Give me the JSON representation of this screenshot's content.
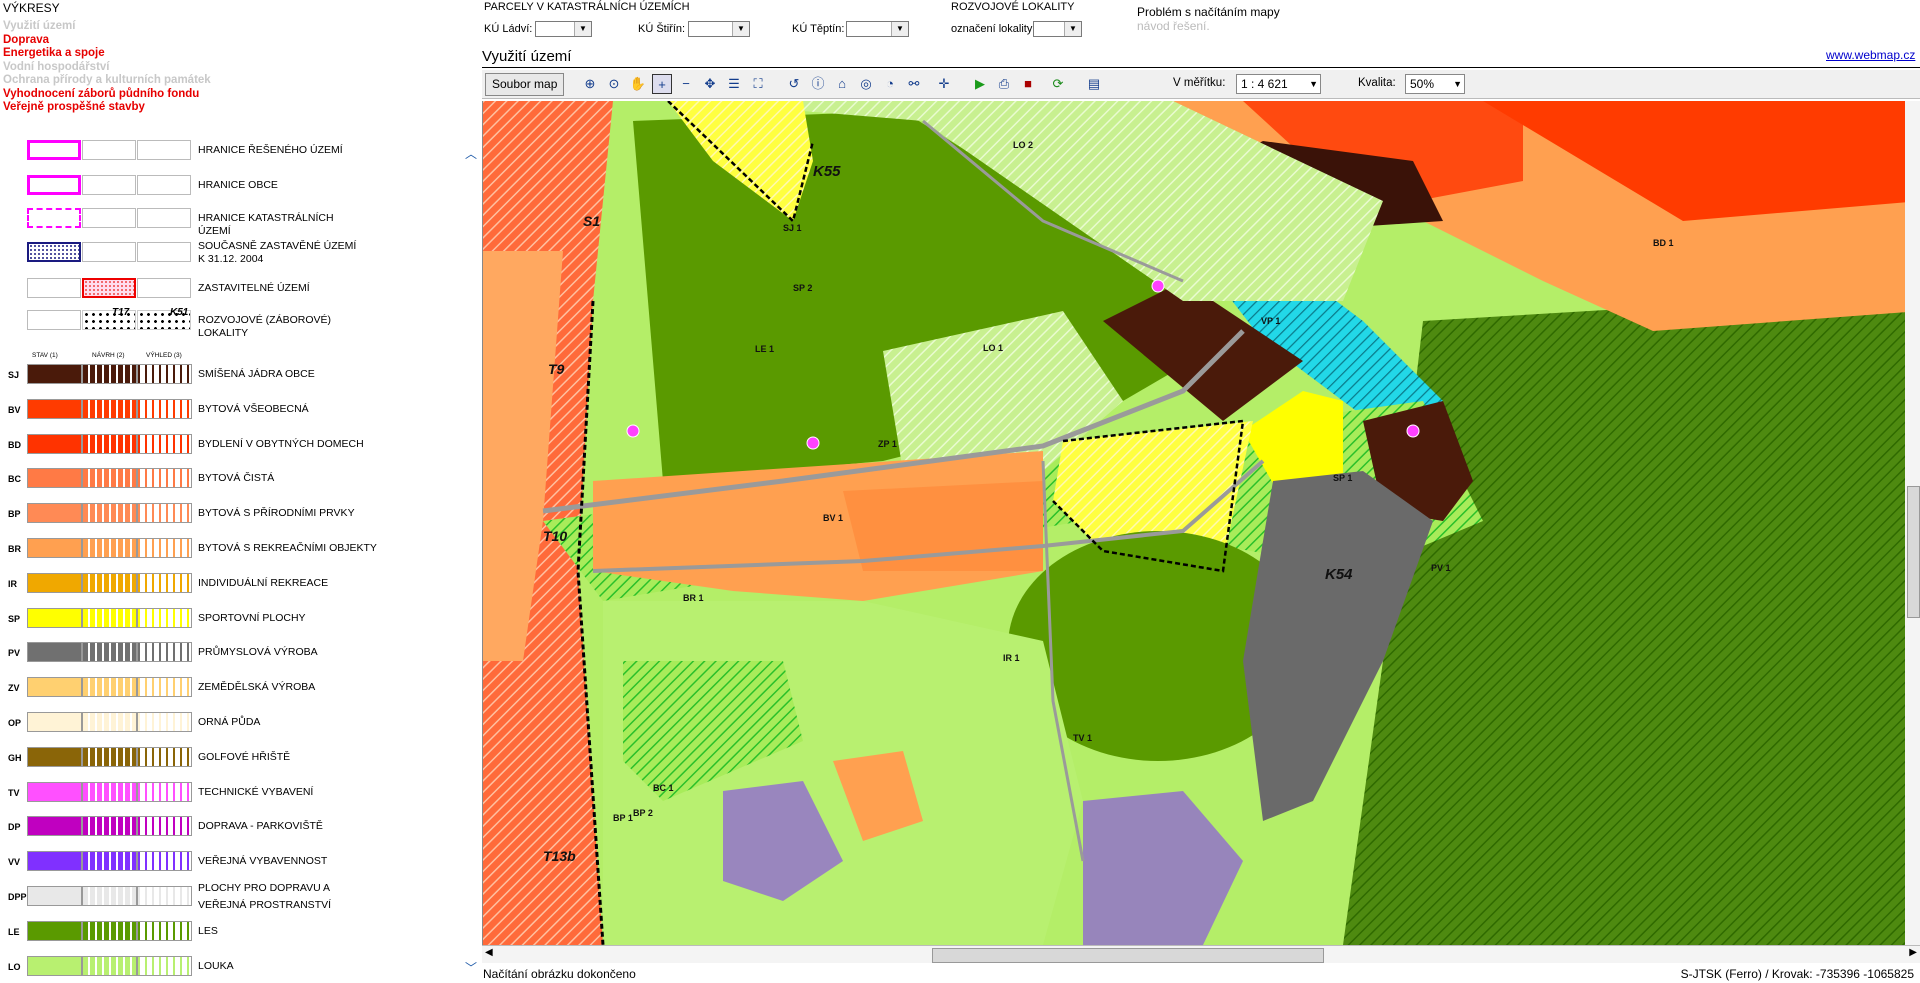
{
  "left": {
    "title": "VÝKRESY",
    "links": [
      {
        "label": "Využití území",
        "color": "#c8c8c8"
      },
      {
        "label": "Doprava",
        "color": "#e60000"
      },
      {
        "label": "Energetika a spoje",
        "color": "#e60000"
      },
      {
        "label": "Vodní hospodářství",
        "color": "#c8c8c8"
      },
      {
        "label": "Ochrana přírody a kulturních památek",
        "color": "#c8c8c8"
      },
      {
        "label": "Vyhodnocení záborů půdního fondu",
        "color": "#e60000"
      },
      {
        "label": "Veřejně prospěšné stavby",
        "color": "#e60000"
      }
    ],
    "boundaries": [
      {
        "label": "HRANICE ŘEŠENÉHO ÚZEMÍ"
      },
      {
        "label": "HRANICE OBCE"
      },
      {
        "label": "HRANICE KATASTRÁLNÍCH ÚZEMÍ"
      },
      {
        "label": "SOUČASNĚ ZASTAVĚNÉ ÚZEMÍ K 31.12. 2004"
      },
      {
        "label": "ZASTAVITELNÉ ÚZEMÍ"
      },
      {
        "label": "ROZVOJOVÉ (ZÁBOROVÉ) LOKALITY",
        "tags": [
          "T17",
          "K51"
        ]
      }
    ],
    "column_headers": [
      "STAV (1)",
      "NÁVRH (2)",
      "VÝHLED (3)"
    ],
    "categories": [
      {
        "code": "SJ",
        "label": "SMÍŠENÁ JÁDRA OBCE",
        "color": "#4a1a0a"
      },
      {
        "code": "BV",
        "label": "BYTOVÁ VŠEOBECNÁ",
        "color": "#ff3b00"
      },
      {
        "code": "BD",
        "label": "BYDLENÍ V OBYTNÝCH DOMECH",
        "color": "#ff3300"
      },
      {
        "code": "BC",
        "label": "BYTOVÁ ČISTÁ",
        "color": "#ff7a45"
      },
      {
        "code": "BP",
        "label": "BYTOVÁ S PŘÍRODNÍMI PRVKY",
        "color": "#ff8a55"
      },
      {
        "code": "BR",
        "label": "BYTOVÁ S REKREAČNÍMI OBJEKTY",
        "color": "#ffa050"
      },
      {
        "code": "IR",
        "label": "INDIVIDUÁLNÍ REKREACE",
        "color": "#f0a800"
      },
      {
        "code": "SP",
        "label": "SPORTOVNÍ PLOCHY",
        "color": "#ffff00"
      },
      {
        "code": "PV",
        "label": "PRŮMYSLOVÁ VÝROBA",
        "color": "#707070"
      },
      {
        "code": "ZV",
        "label": "ZEMĚDĚLSKÁ VÝROBA",
        "color": "#ffd070"
      },
      {
        "code": "OP",
        "label": "ORNÁ PŮDA",
        "color": "#fff3d6"
      },
      {
        "code": "GH",
        "label": "GOLFOVÉ HŘIŠTĚ",
        "color": "#8a6508"
      },
      {
        "code": "TV",
        "label": "TECHNICKÉ VYBAVENÍ",
        "color": "#ff50ff"
      },
      {
        "code": "DP",
        "label": "DOPRAVA - PARKOVIŠTĚ",
        "color": "#c000c0"
      },
      {
        "code": "VV",
        "label": "VEŘEJNÁ VYBAVENNOST",
        "color": "#8030ff"
      },
      {
        "code": "DPP",
        "label": "PLOCHY PRO DOPRAVU A VEŘEJNÁ PROSTRANSTVÍ",
        "color": "#e8e8e8"
      },
      {
        "code": "LE",
        "label": "LES",
        "color": "#5a9a00"
      },
      {
        "code": "LO",
        "label": "LOUKA",
        "color": "#b8f070"
      }
    ]
  },
  "header": {
    "parcely_title": "PARCELY V KATASTRÁLNÍCH ÚZEMÍCH",
    "ku_ladvi": "KÚ Ládví:",
    "ku_stirin": "KÚ Štiřín:",
    "ku_teptin": "KÚ Těptín:",
    "rozvojove_title": "ROZVOJOVÉ LOKALITY",
    "oznaceni": "označení lokality",
    "problem": "Problém s načítáním mapy",
    "navod": "návod řešení.",
    "map_title": "Využití území",
    "webmap": "www.webmap.cz"
  },
  "toolbar": {
    "soubor": "Soubor map",
    "meritko_label": "V měřítku:",
    "meritko_value": "1 : 4 621",
    "kvalita_label": "Kvalita:",
    "kvalita_value": "50%"
  },
  "map": {
    "labels": [
      "K55",
      "K54",
      "S1",
      "T9",
      "T10",
      "T13b",
      "LO 2",
      "LO 1",
      "LE 1",
      "SP 2",
      "SJ 1",
      "SP 1",
      "ZP 1",
      "BV 1",
      "BR 1",
      "PV 1",
      "VP 1",
      "IR 1",
      "TV 1",
      "BC 1",
      "BP 1",
      "BD 1",
      "BP 2"
    ]
  },
  "status": {
    "left": "Načítání obrázku dokončeno",
    "right": "S-JTSK (Ferro) / Krovak: -735396 -1065825"
  },
  "colors": {
    "link_red": "#e60000",
    "link_grey": "#c8c8c8",
    "webmap_link": "#0000cc"
  }
}
